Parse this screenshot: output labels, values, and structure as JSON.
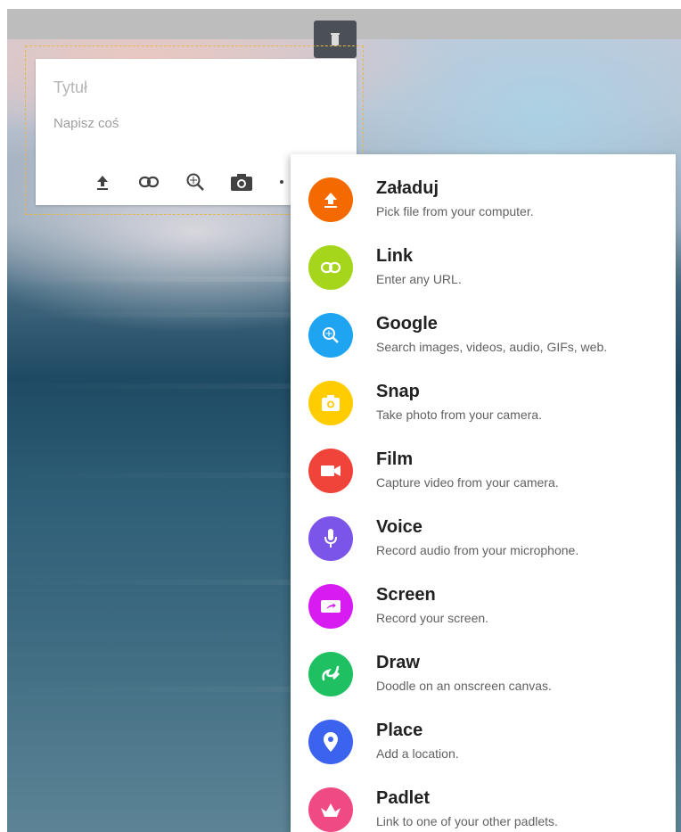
{
  "editor": {
    "title_placeholder": "Tytuł",
    "body_placeholder": "Napisz coś",
    "tools": [
      {
        "icon": "upload-icon"
      },
      {
        "icon": "link-icon"
      },
      {
        "icon": "search-icon"
      },
      {
        "icon": "camera-icon"
      },
      {
        "icon": "more-icon"
      }
    ]
  },
  "menu": {
    "items": [
      {
        "title": "Załaduj",
        "desc": "Pick file from your computer.",
        "color": "#f56a00",
        "icon": "upload-icon"
      },
      {
        "title": "Link",
        "desc": "Enter any URL.",
        "color": "#a5d61c",
        "icon": "link-icon"
      },
      {
        "title": "Google",
        "desc": "Search images, videos, audio, GIFs, web.",
        "color": "#1ea4f0",
        "icon": "search-icon"
      },
      {
        "title": "Snap",
        "desc": "Take photo from your camera.",
        "color": "#ffcc00",
        "icon": "camera-icon"
      },
      {
        "title": "Film",
        "desc": "Capture video from your camera.",
        "color": "#f0443a",
        "icon": "video-icon"
      },
      {
        "title": "Voice",
        "desc": "Record audio from your microphone.",
        "color": "#7a55e8",
        "icon": "microphone-icon"
      },
      {
        "title": "Screen",
        "desc": "Record your screen.",
        "color": "#d61cf0",
        "icon": "screen-icon"
      },
      {
        "title": "Draw",
        "desc": "Doodle on an onscreen canvas.",
        "color": "#1fc061",
        "icon": "draw-icon"
      },
      {
        "title": "Place",
        "desc": "Add a location.",
        "color": "#3b63ee",
        "icon": "location-pin-icon"
      },
      {
        "title": "Padlet",
        "desc": "Link to one of your other padlets.",
        "color": "#f04a84",
        "icon": "padlet-icon"
      }
    ]
  }
}
